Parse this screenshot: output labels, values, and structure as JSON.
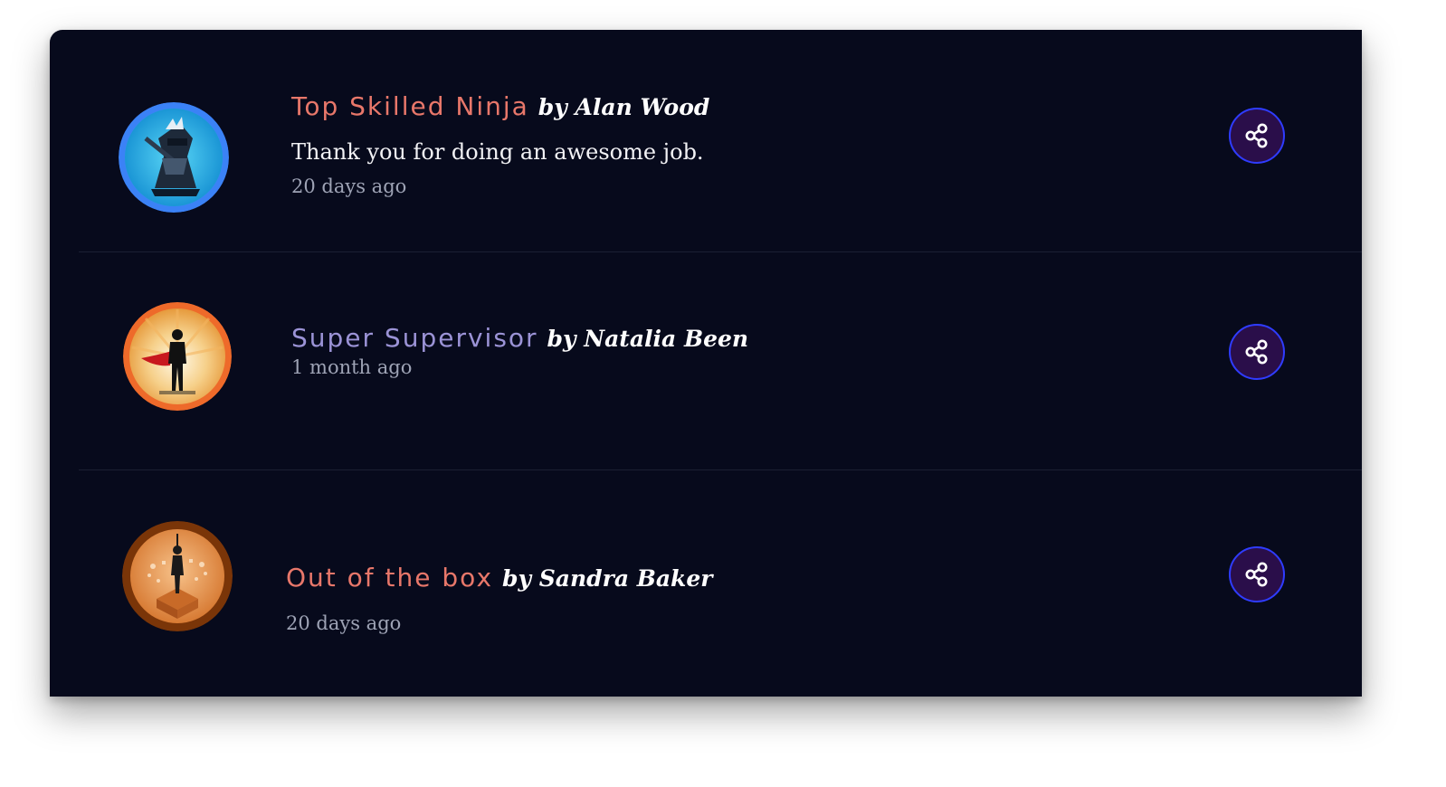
{
  "feed": {
    "items": [
      {
        "badge_title": "Top Skilled Ninja",
        "author": "by Alan Wood",
        "message": "Thank you for doing an awesome job.",
        "time": "20 days ago",
        "title_color": "#e8776a",
        "avatar_icon": "ninja-avatar",
        "share_icon": "share-icon"
      },
      {
        "badge_title": "Super Supervisor",
        "author": "by Natalia Been",
        "time": "1 month ago",
        "title_color": "#9b93d6",
        "avatar_icon": "superhero-avatar",
        "share_icon": "share-icon"
      },
      {
        "badge_title": "Out of the box",
        "author": "by Sandra Baker",
        "time": "20 days ago",
        "title_color": "#e8776a",
        "avatar_icon": "out-of-the-box-avatar",
        "share_icon": "share-icon"
      }
    ]
  },
  "colors": {
    "background": "#070a1c",
    "share_button_fill": "#2a0e4a",
    "share_button_border": "#2f3cff"
  }
}
